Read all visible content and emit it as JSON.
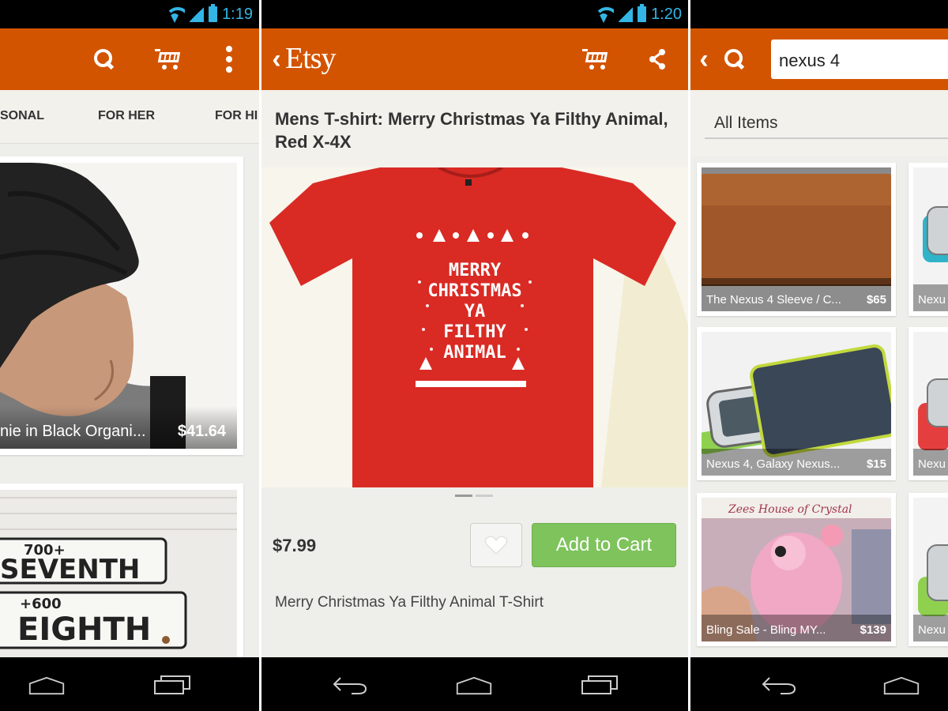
{
  "screens": {
    "left": {
      "status": {
        "time": "1:19"
      },
      "tabs": [
        "SONAL",
        "FOR HER",
        "FOR HI"
      ],
      "cards": [
        {
          "title": "nie in Black Organi...",
          "price": "$41.64"
        }
      ],
      "icons": [
        "search-icon",
        "cart-icon",
        "overflow-menu-icon"
      ]
    },
    "middle": {
      "status": {
        "time": "1:20"
      },
      "logo": "Etsy",
      "product_title": "Mens T-shirt: Merry Christmas Ya Filthy Animal, Red X-4X",
      "shirt_text": [
        "MERRY",
        "CHRISTMAS",
        "YA",
        "FILTHY",
        "ANIMAL"
      ],
      "price": "$7.99",
      "add_to_cart_label": "Add to Cart",
      "description": "Merry Christmas Ya Filthy Animal T-Shirt",
      "icons": [
        "back-icon",
        "cart-icon",
        "share-icon",
        "heart-icon"
      ]
    },
    "right": {
      "search_value": "nexus 4",
      "filter_label": "All Items",
      "cards": [
        {
          "title": "The Nexus 4 Sleeve / C...",
          "price": "$65"
        },
        {
          "title": "Nexu",
          "price": ""
        },
        {
          "title": "Nexus 4, Galaxy Nexus...",
          "price": "$15"
        },
        {
          "title": "Nexu",
          "price": ""
        },
        {
          "title": "Bling Sale - Bling MY...",
          "price": "$139"
        },
        {
          "title": "Nexu",
          "price": ""
        }
      ],
      "card_image_text": "Zees House of Crystal",
      "icons": [
        "back-icon",
        "search-icon"
      ]
    }
  },
  "colors": {
    "action_bar": "#d35400",
    "status_accent": "#33b5e5",
    "add_to_cart": "#7ec35c",
    "background": "#eeeeea"
  }
}
